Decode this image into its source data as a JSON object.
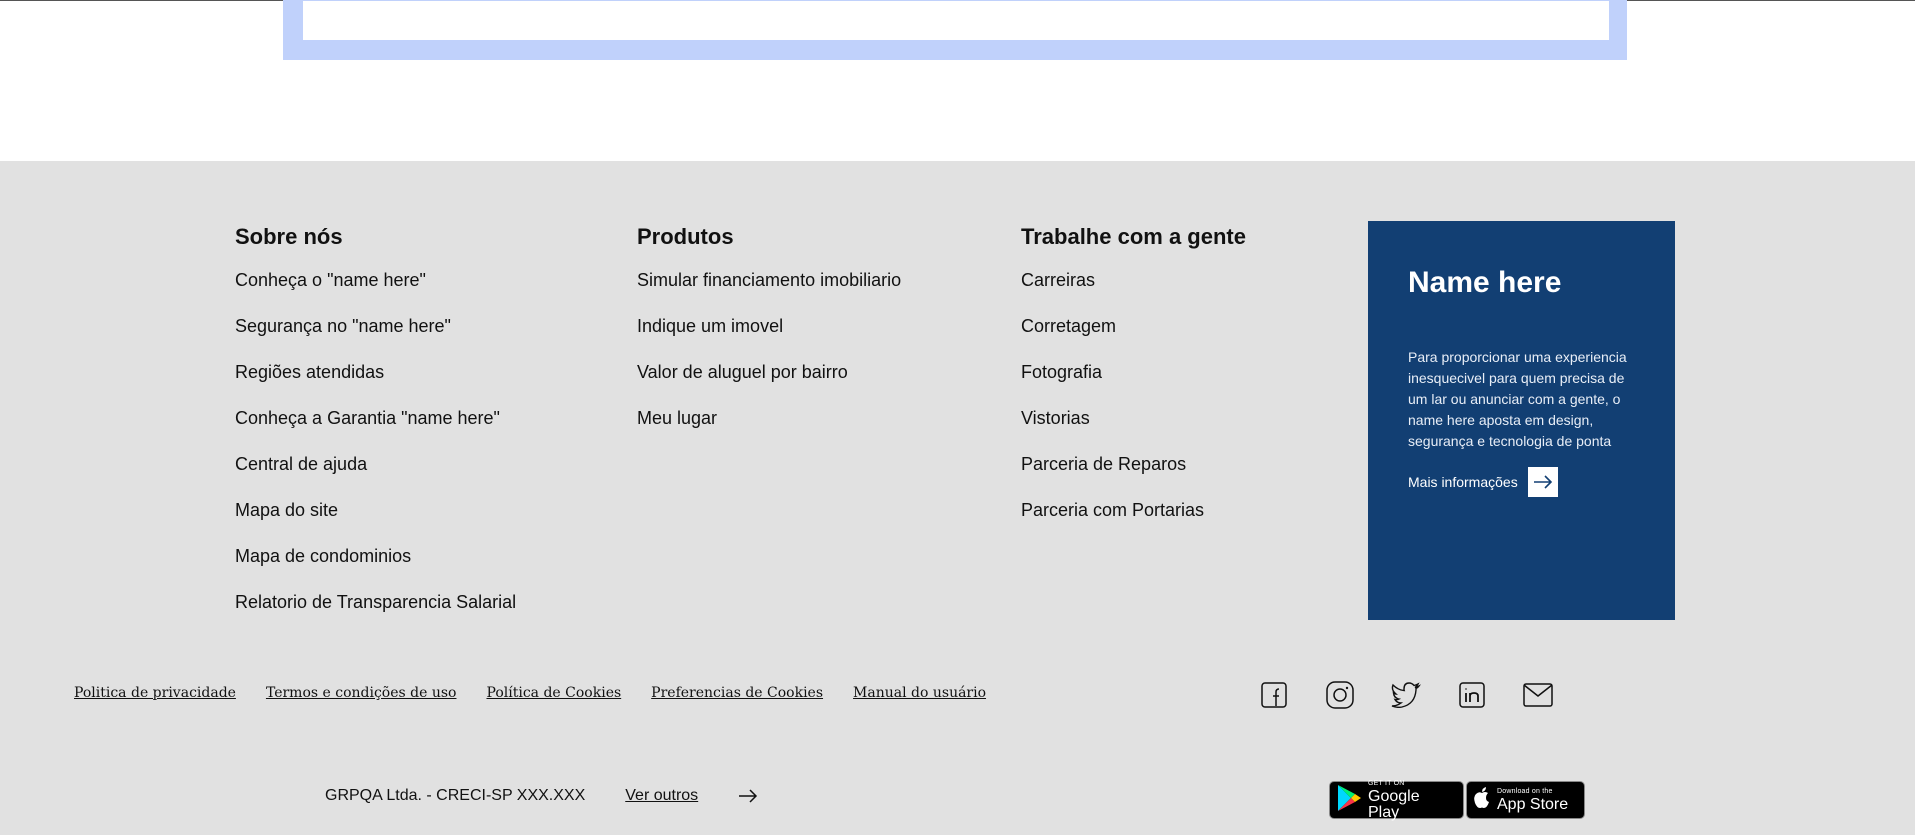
{
  "columns": [
    {
      "heading": "Sobre nós",
      "links": [
        "Conheça o \"name here\"",
        "Segurança no \"name here\"",
        "Regiões atendidas",
        "Conheça a Garantia \"name here\"",
        "Central de ajuda",
        "Mapa do site",
        "Mapa de condominios",
        "Relatorio de Transparencia Salarial"
      ]
    },
    {
      "heading": "Produtos",
      "links": [
        "Simular financiamento imobiliario",
        "Indique um imovel",
        "Valor de aluguel por bairro",
        "Meu lugar"
      ]
    },
    {
      "heading": "Trabalhe com a gente",
      "links": [
        "Carreiras",
        "Corretagem",
        "Fotografia",
        "Vistorias",
        "Parceria de Reparos",
        "Parceria com Portarias"
      ]
    }
  ],
  "promo": {
    "title": "Name here",
    "text": "Para proporcionar uma experiencia inesquecivel para quem precisa de um lar ou anunciar com a gente, o name here aposta em design, segurança e tecnologia de ponta",
    "more_label": "Mais informações",
    "background": "#123f73"
  },
  "legal_links": [
    "Politica de privacidade",
    "Termos e condições de uso",
    "Política de Cookies",
    "Preferencias de Cookies",
    "Manual do usuário"
  ],
  "social_icons": [
    "facebook-icon",
    "instagram-icon",
    "twitter-icon",
    "linkedin-icon",
    "mail-icon"
  ],
  "bottom": {
    "company": "GRPQA Ltda. - CRECI-SP XXX.XXX",
    "ver_outros": "Ver outros"
  },
  "stores": {
    "google_small": "GET IT ON",
    "google_big": "Google Play",
    "apple_small": "Download on the",
    "apple_big": "App Store"
  }
}
